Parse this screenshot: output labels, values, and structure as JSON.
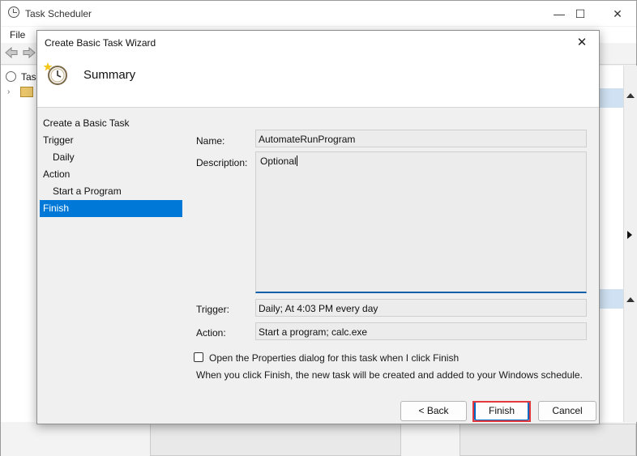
{
  "main_window": {
    "title": "Task Scheduler",
    "controls": {
      "minimize": "—",
      "maximize": "☐",
      "close": "✕"
    },
    "menu": {
      "file": "File"
    },
    "tree_text": "Tas"
  },
  "dialog": {
    "title": "Create Basic Task Wizard",
    "close": "✕",
    "header_title": "Summary",
    "steps": [
      {
        "label": "Create a Basic Task"
      },
      {
        "label": "Trigger"
      },
      {
        "label": "Daily"
      },
      {
        "label": "Action"
      },
      {
        "label": "Start a Program"
      },
      {
        "label": "Finish",
        "active": true
      }
    ],
    "form": {
      "name_label": "Name:",
      "name_value": "AutomateRunProgram",
      "description_label": "Description:",
      "description_value": "Optional",
      "trigger_label": "Trigger:",
      "trigger_value": "Daily; At 4:03 PM every day",
      "action_label": "Action:",
      "action_value": "Start a program; calc.exe"
    },
    "open_properties_checkbox": {
      "label": "Open the Properties dialog for this task when I click Finish",
      "checked": false
    },
    "info_text": "When you click Finish, the new task will be created and added to your Windows schedule.",
    "buttons": {
      "back": "< Back",
      "finish": "Finish",
      "cancel": "Cancel"
    }
  },
  "colors": {
    "selection": "#0078d7",
    "focus_highlight": "#e0393e",
    "primary_border": "#0067c0"
  }
}
